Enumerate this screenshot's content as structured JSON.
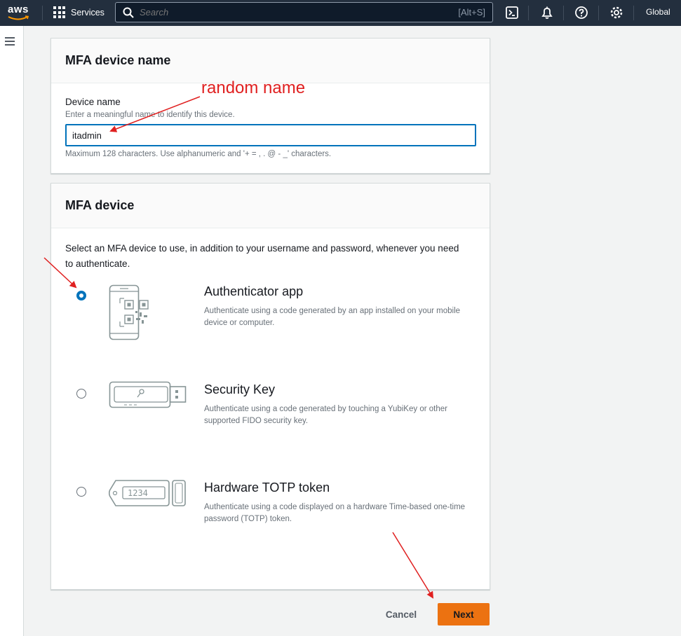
{
  "topnav": {
    "logo": "aws",
    "services_label": "Services",
    "search_placeholder": "Search",
    "search_shortcut": "[Alt+S]",
    "region_label": "Global"
  },
  "device_name_panel": {
    "title": "MFA device name",
    "field_label": "Device name",
    "field_description": "Enter a meaningful name to identify this device.",
    "field_value": "itadmin",
    "field_constraint": "Maximum 128 characters. Use alphanumeric and '+ = , . @ - _' characters."
  },
  "mfa_device_panel": {
    "title": "MFA device",
    "intro": "Select an MFA device to use, in addition to your username and password, whenever you need to authenticate.",
    "options": [
      {
        "title": "Authenticator app",
        "description": "Authenticate using a code generated by an app installed on your mobile device or computer.",
        "selected": true,
        "icon": "phone-qr-icon"
      },
      {
        "title": "Security Key",
        "description": "Authenticate using a code generated by touching a YubiKey or other supported FIDO security key.",
        "selected": false,
        "icon": "usb-key-icon"
      },
      {
        "title": "Hardware TOTP token",
        "description": "Authenticate using a code displayed on a hardware Time-based one-time password (TOTP) token.",
        "selected": false,
        "icon": "totp-token-icon",
        "token_display": "1234"
      }
    ]
  },
  "actions": {
    "cancel_label": "Cancel",
    "next_label": "Next"
  },
  "annotation": {
    "text": "random name",
    "color": "#e02020"
  },
  "colors": {
    "nav_bg": "#232f3e",
    "primary_button": "#ec7211",
    "focus_blue": "#0073bb"
  }
}
